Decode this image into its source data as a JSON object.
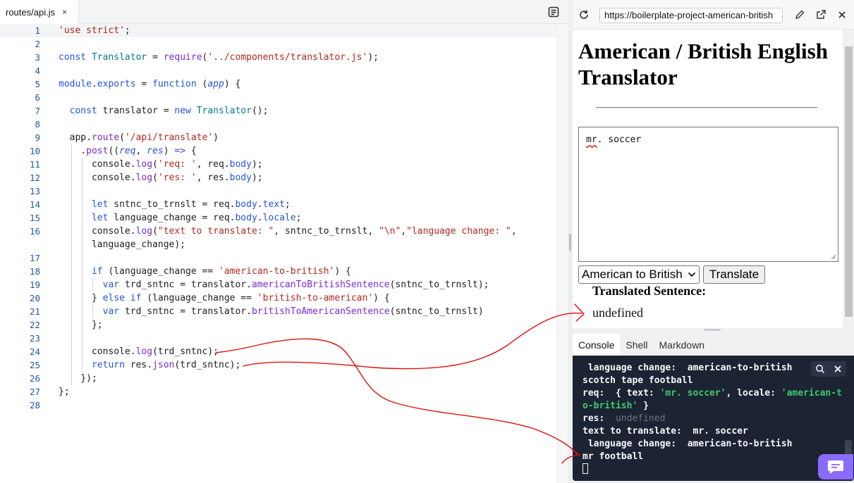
{
  "editor": {
    "tab_label": "routes/api.js",
    "tab_close": "×",
    "lines": [
      {
        "n": "1",
        "active": true,
        "indent": [],
        "tokens": [
          [
            "str",
            "'use strict'"
          ],
          [
            "",
            "; "
          ]
        ]
      },
      {
        "n": "2",
        "indent": [],
        "tokens": []
      },
      {
        "n": "3",
        "indent": [],
        "tokens": [
          [
            "kw",
            "const "
          ],
          [
            "cls",
            "Translator"
          ],
          [
            "",
            " = "
          ],
          [
            "fn",
            "require"
          ],
          [
            "",
            "("
          ],
          [
            "str",
            "'../components/translator.js'"
          ],
          [
            "",
            ");"
          ]
        ]
      },
      {
        "n": "4",
        "indent": [],
        "tokens": []
      },
      {
        "n": "5",
        "indent": [],
        "tokens": [
          [
            "kw",
            "module"
          ],
          [
            "",
            "."
          ],
          [
            "prop",
            "exports"
          ],
          [
            "",
            " = "
          ],
          [
            "kw",
            "function "
          ],
          [
            "",
            "("
          ],
          [
            "it",
            "app"
          ],
          [
            "",
            ") {"
          ]
        ]
      },
      {
        "n": "6",
        "indent": [],
        "tokens": []
      },
      {
        "n": "7",
        "indent": [],
        "tokens": [
          [
            "",
            "  "
          ],
          [
            "kw",
            "const "
          ],
          [
            "",
            "translator = "
          ],
          [
            "kw",
            "new "
          ],
          [
            "cls",
            "Translator"
          ],
          [
            "",
            "();"
          ]
        ]
      },
      {
        "n": "8",
        "indent": [],
        "tokens": []
      },
      {
        "n": "9",
        "indent": [],
        "tokens": [
          [
            "",
            "  app."
          ],
          [
            "fn",
            "route"
          ],
          [
            "",
            "("
          ],
          [
            "str",
            "'/api/translate'"
          ],
          [
            "",
            ")"
          ]
        ]
      },
      {
        "n": "10",
        "indent": [
          1
        ],
        "tokens": [
          [
            "",
            "    ."
          ],
          [
            "fn",
            "post"
          ],
          [
            "",
            "(("
          ],
          [
            "it",
            "req"
          ],
          [
            "",
            ", "
          ],
          [
            "it",
            "res"
          ],
          [
            "",
            ") "
          ],
          [
            "kw",
            "=>"
          ],
          [
            "",
            " {"
          ]
        ]
      },
      {
        "n": "11",
        "indent": [
          1,
          2
        ],
        "tokens": [
          [
            "",
            "      console."
          ],
          [
            "fn",
            "log"
          ],
          [
            "",
            "("
          ],
          [
            "str",
            "'req: '"
          ],
          [
            "",
            ", req."
          ],
          [
            "prop",
            "body"
          ],
          [
            "",
            ");"
          ]
        ]
      },
      {
        "n": "12",
        "indent": [
          1,
          2
        ],
        "tokens": [
          [
            "",
            "      console."
          ],
          [
            "fn",
            "log"
          ],
          [
            "",
            "("
          ],
          [
            "str",
            "'res: '"
          ],
          [
            "",
            ", res."
          ],
          [
            "prop",
            "body"
          ],
          [
            "",
            ");"
          ]
        ]
      },
      {
        "n": "13",
        "indent": [
          1,
          2
        ],
        "tokens": []
      },
      {
        "n": "14",
        "indent": [
          1,
          2
        ],
        "tokens": [
          [
            "",
            "      "
          ],
          [
            "kw",
            "let "
          ],
          [
            "",
            "sntnc_to_trnslt = req."
          ],
          [
            "prop",
            "body"
          ],
          [
            "",
            "."
          ],
          [
            "prop",
            "text"
          ],
          [
            "",
            ";"
          ]
        ]
      },
      {
        "n": "15",
        "indent": [
          1,
          2
        ],
        "tokens": [
          [
            "",
            "      "
          ],
          [
            "kw",
            "let "
          ],
          [
            "",
            "language_change = req."
          ],
          [
            "prop",
            "body"
          ],
          [
            "",
            "."
          ],
          [
            "prop",
            "locale"
          ],
          [
            "",
            ";"
          ]
        ]
      },
      {
        "n": "16",
        "indent": [
          1,
          2
        ],
        "tokens": [
          [
            "",
            "      console."
          ],
          [
            "fn",
            "log"
          ],
          [
            "",
            "("
          ],
          [
            "str",
            "\"text to translate: \""
          ],
          [
            "",
            ", sntnc_to_trnslt, "
          ],
          [
            "str",
            "\"\\n\""
          ],
          [
            "",
            ","
          ],
          [
            "str",
            "\"language change: \""
          ],
          [
            "",
            ","
          ]
        ]
      },
      {
        "n": "",
        "indent": [
          1,
          2
        ],
        "tokens": [
          [
            "",
            "      language_change);"
          ]
        ]
      },
      {
        "n": "17",
        "indent": [
          1,
          2
        ],
        "tokens": []
      },
      {
        "n": "18",
        "indent": [
          1,
          2
        ],
        "tokens": [
          [
            "",
            "      "
          ],
          [
            "kw",
            "if "
          ],
          [
            "",
            "(language_change == "
          ],
          [
            "str",
            "'american-to-british'"
          ],
          [
            "",
            ") {"
          ]
        ]
      },
      {
        "n": "19",
        "indent": [
          1,
          2,
          3
        ],
        "tokens": [
          [
            "",
            "        "
          ],
          [
            "kw",
            "var "
          ],
          [
            "",
            "trd_sntnc = translator."
          ],
          [
            "fn",
            "americanToBritishSentence"
          ],
          [
            "",
            "(sntnc_to_trnslt);"
          ]
        ]
      },
      {
        "n": "20",
        "indent": [
          1,
          2
        ],
        "tokens": [
          [
            "",
            "      } "
          ],
          [
            "kw",
            "else if "
          ],
          [
            "",
            "(language_change == "
          ],
          [
            "str",
            "'british-to-american'"
          ],
          [
            "",
            ") {"
          ]
        ]
      },
      {
        "n": "21",
        "indent": [
          1,
          2,
          3
        ],
        "tokens": [
          [
            "",
            "        "
          ],
          [
            "kw",
            "var "
          ],
          [
            "",
            "trd_sntnc = translator."
          ],
          [
            "fn",
            "britishToAmericanSentence"
          ],
          [
            "",
            "(sntnc_to_trnslt)"
          ]
        ]
      },
      {
        "n": "22",
        "indent": [
          1,
          2
        ],
        "tokens": [
          [
            "",
            "      };"
          ]
        ]
      },
      {
        "n": "23",
        "indent": [
          1,
          2
        ],
        "tokens": []
      },
      {
        "n": "24",
        "indent": [
          1,
          2
        ],
        "tokens": [
          [
            "",
            "      console."
          ],
          [
            "fn",
            "log"
          ],
          [
            "",
            "(trd_sntnc);"
          ]
        ]
      },
      {
        "n": "25",
        "indent": [
          1,
          2
        ],
        "tokens": [
          [
            "",
            "      "
          ],
          [
            "kw",
            "return "
          ],
          [
            "",
            "res."
          ],
          [
            "fn",
            "json"
          ],
          [
            "",
            "(trd_sntnc);"
          ]
        ]
      },
      {
        "n": "26",
        "indent": [
          1
        ],
        "tokens": [
          [
            "",
            "    });"
          ]
        ]
      },
      {
        "n": "27",
        "indent": [],
        "tokens": [
          [
            "",
            "};"
          ]
        ]
      },
      {
        "n": "28",
        "indent": [],
        "tokens": []
      }
    ]
  },
  "webview": {
    "url": "https://boilerplate-project-american-british",
    "heading": "American / British English Translator",
    "textarea_value": "mr. soccer",
    "textarea_word1": "mr",
    "textarea_rest": ". soccer",
    "select_value": "American to British",
    "translate_label": "Translate",
    "result_label": "Translated Sentence:",
    "result_value": "undefined"
  },
  "console": {
    "tabs": [
      "Console",
      "Shell",
      "Markdown"
    ],
    "lines": [
      [
        [
          "",
          " language change:  american-to-british"
        ]
      ],
      [
        [
          "",
          "scotch tape football"
        ]
      ],
      [
        [
          "",
          "req:  { text: "
        ],
        [
          "str",
          "'mr. soccer'"
        ],
        [
          "",
          ", locale: "
        ],
        [
          "str",
          "'american-to-british'"
        ],
        [
          "",
          " }"
        ]
      ],
      [
        [
          "",
          "res:  "
        ],
        [
          "dim",
          "undefined"
        ]
      ],
      [
        [
          "",
          "text to translate:  mr. soccer"
        ]
      ],
      [
        [
          "",
          " language change:  american-to-british"
        ]
      ],
      [
        [
          "",
          "mr football"
        ]
      ]
    ]
  },
  "colors": {
    "accent": "#8b6bff",
    "terminal_bg": "#1c2333",
    "annotation": "#e01010"
  },
  "icons": [
    "outline-icon",
    "reload-icon",
    "edit-icon",
    "open-external-icon",
    "close-icon",
    "search-icon",
    "chat-icon"
  ]
}
